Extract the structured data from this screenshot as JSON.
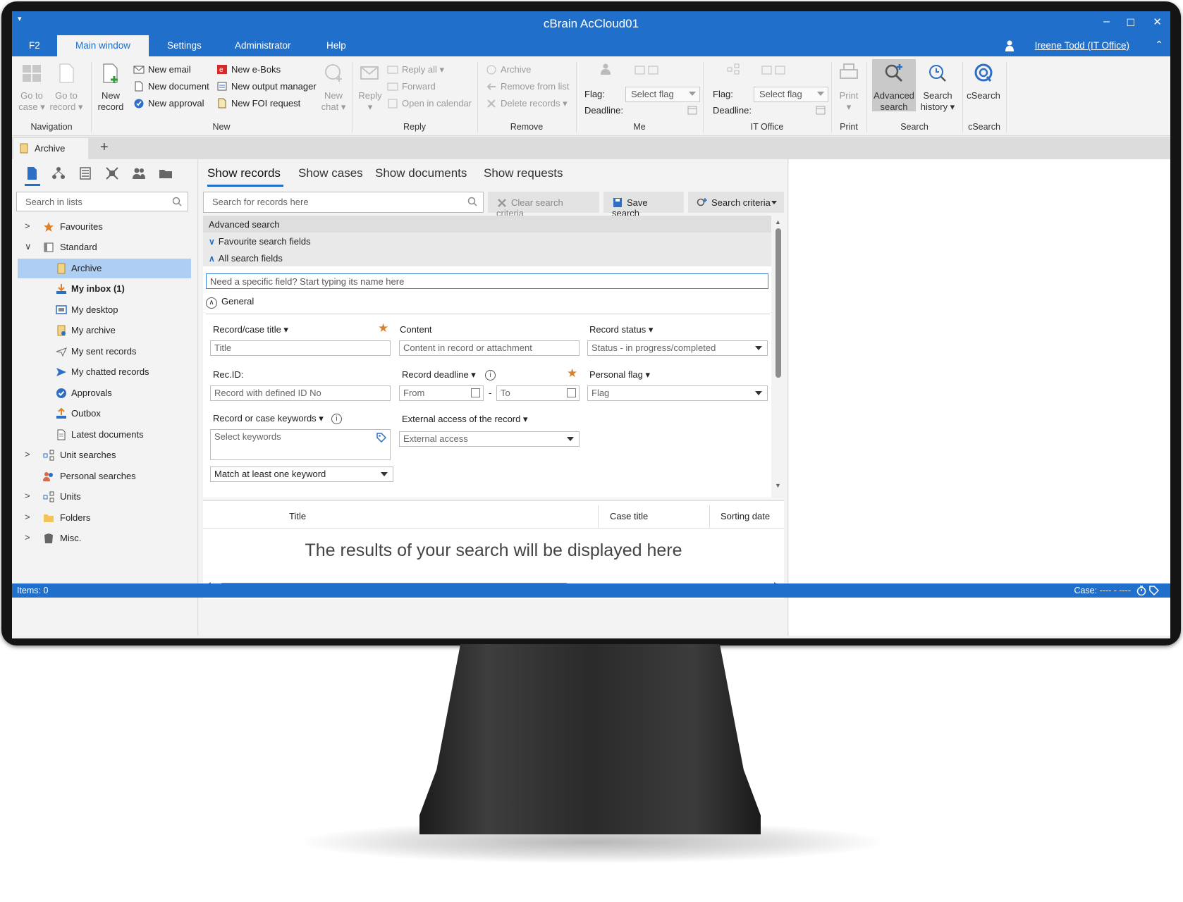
{
  "window": {
    "app_title": "cBrain AcCloud01",
    "quick_access": "▾",
    "minimize": "–",
    "maximize": "☐",
    "close": "✕"
  },
  "menu": {
    "f2": "F2",
    "tabs": [
      "Main window",
      "Settings",
      "Administrator",
      "Help"
    ],
    "user": "Ireene Todd (IT Office)",
    "collapse": "⌃"
  },
  "ribbon": {
    "navigation": {
      "label": "Navigation",
      "go_to_case": [
        "Go to",
        "case ▾"
      ],
      "go_to_record": [
        "Go to",
        "record ▾"
      ]
    },
    "new": {
      "label": "New",
      "new_record": [
        "New",
        "record"
      ],
      "items": [
        "New email",
        "New document",
        "New approval",
        "New e-Boks",
        "New output manager",
        "New FOI request"
      ],
      "new_chat": [
        "New",
        "chat ▾"
      ]
    },
    "reply": {
      "label": "Reply",
      "reply": [
        "Reply",
        "▾"
      ],
      "items": [
        "Reply all ▾",
        "Forward",
        "Open in calendar"
      ]
    },
    "remove": {
      "label": "Remove",
      "items": [
        "Archive",
        "Remove from list",
        "Delete records ▾"
      ]
    },
    "me": {
      "label": "Me",
      "flag": "Flag:",
      "deadline": "Deadline:",
      "select_flag": "Select flag"
    },
    "it_office": {
      "label": "IT Office",
      "flag": "Flag:",
      "deadline": "Deadline:",
      "select_flag": "Select flag"
    },
    "print": {
      "label": "Print",
      "print": [
        "Print",
        "▾"
      ]
    },
    "search": {
      "label": "Search",
      "advanced": [
        "Advanced",
        "search"
      ],
      "history": [
        "Search",
        "history ▾"
      ]
    },
    "csearch": {
      "label": "cSearch",
      "csearch": "cSearch"
    }
  },
  "doc_tabs": {
    "active": "Archive",
    "add": "+"
  },
  "left": {
    "search_placeholder": "Search in lists",
    "tree": [
      {
        "label": "Favourites",
        "arrow": ">"
      },
      {
        "label": "Standard",
        "arrow": "∨"
      },
      {
        "label": "Archive",
        "arrow": ""
      },
      {
        "label": "My inbox (1)",
        "arrow": ""
      },
      {
        "label": "My desktop",
        "arrow": ""
      },
      {
        "label": "My archive",
        "arrow": ""
      },
      {
        "label": "My sent records",
        "arrow": ""
      },
      {
        "label": "My chatted records",
        "arrow": ""
      },
      {
        "label": "Approvals",
        "arrow": ""
      },
      {
        "label": "Outbox",
        "arrow": ""
      },
      {
        "label": "Latest documents",
        "arrow": ""
      },
      {
        "label": "Unit searches",
        "arrow": ">"
      },
      {
        "label": "Personal searches",
        "arrow": ""
      },
      {
        "label": "Units",
        "arrow": ">"
      },
      {
        "label": "Folders",
        "arrow": ">"
      },
      {
        "label": "Misc.",
        "arrow": ">"
      }
    ]
  },
  "center": {
    "tabs": [
      "Show records",
      "Show cases",
      "Show documents",
      "Show requests"
    ],
    "search_placeholder": "Search for records here",
    "clear": "Clear search criteria",
    "save": "Save search",
    "criteria": "Search criteria",
    "advanced_search": "Advanced search",
    "favourite_fields": "Favourite search fields",
    "all_fields": "All search fields",
    "field_search_placeholder": "Need a specific field? Start typing its name here",
    "general": "General",
    "fields": {
      "title_label": "Record/case title ▾",
      "title_ph": "Title",
      "content_label": "Content",
      "content_ph": "Content in record or attachment",
      "status_label": "Record status ▾",
      "status_ph": "Status - in progress/completed",
      "recid_label": "Rec.ID:",
      "recid_ph": "Record with defined ID No",
      "deadline_label": "Record deadline ▾",
      "from_ph": "From",
      "to_ph": "To",
      "dash": "-",
      "pflag_label": "Personal flag ▾",
      "pflag_ph": "Flag",
      "keywords_label": "Record or case keywords ▾",
      "keywords_ph": "Select keywords",
      "ext_label": "External access of the record ▾",
      "ext_ph": "External access",
      "match": "Match at least one keyword"
    },
    "results": {
      "col_title": "Title",
      "col_case": "Case title",
      "col_date": "Sorting date",
      "placeholder": "The results of your search will be displayed here"
    }
  },
  "status": {
    "items": "Items: 0",
    "case": "Case: ---- - ----"
  },
  "colors": {
    "accent": "#1f6fcb",
    "selected": "#aecff3",
    "star": "#d9822b"
  }
}
